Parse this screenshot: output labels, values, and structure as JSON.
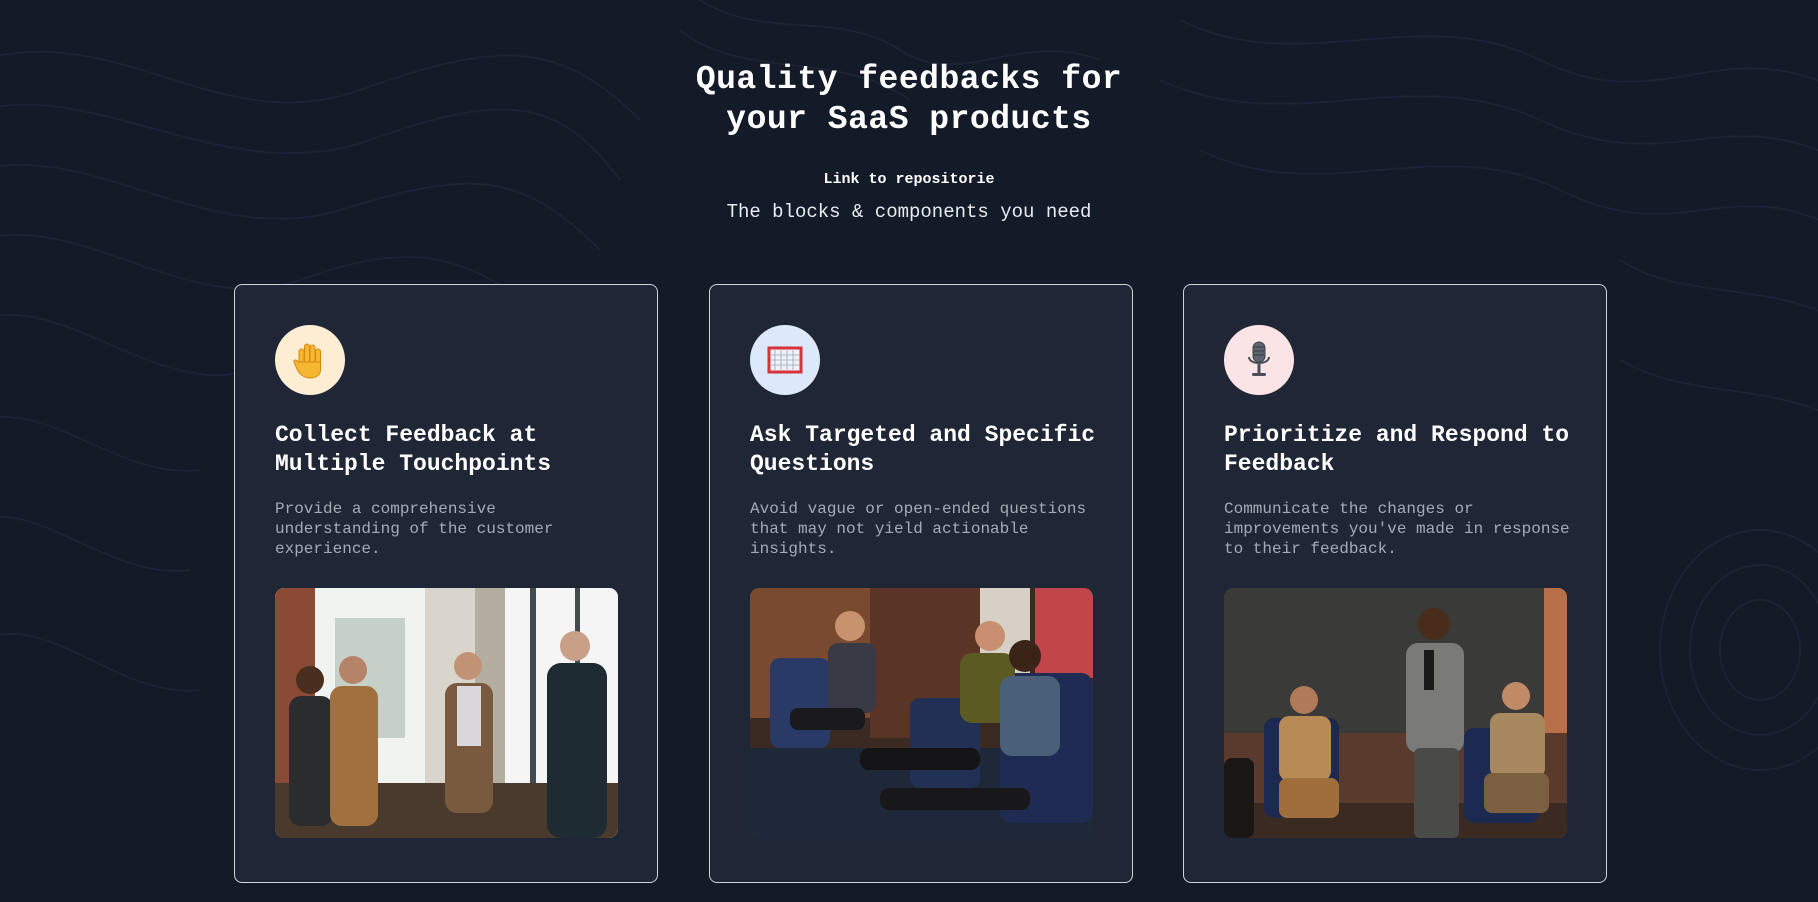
{
  "hero": {
    "title_line1": "Quality feedbacks for",
    "title_line2": "your SaaS products",
    "repo_link": "Link to repositorie",
    "subtitle": "The blocks & components you need"
  },
  "colors": {
    "background": "#131a28",
    "card_background": "#1f2635",
    "card_border": "#cfd3da",
    "heading": "#ffffff",
    "muted_text": "#a4abb8"
  },
  "cards": [
    {
      "icon": "raised-hand-icon",
      "icon_bg": "#fdedd3",
      "title": "Collect Feedback at Multiple Touchpoints",
      "description": "Provide a comprehensive understanding of the customer experience.",
      "image": "group-of-men-talking-by-window-photo"
    },
    {
      "icon": "goal-net-icon",
      "icon_bg": "#dde8fb",
      "title": "Ask Targeted and Specific Questions",
      "description": "Avoid vague or open-ended questions that may not yield actionable insights.",
      "image": "seated-group-discussion-photo"
    },
    {
      "icon": "microphone-icon",
      "icon_bg": "#fbe4e6",
      "title": "Prioritize and Respond to Feedback",
      "description": "Communicate the changes or improvements you've made in response to their feedback.",
      "image": "speaker-presenting-photo"
    }
  ]
}
